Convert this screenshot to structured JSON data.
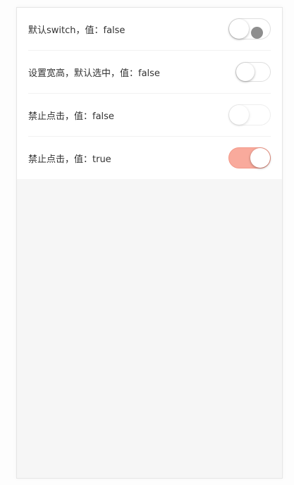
{
  "items": [
    {
      "label": "默认switch，值：false",
      "checked": false,
      "disabled": false
    },
    {
      "label": "设置宽高，默认选中，值：false",
      "checked": false,
      "disabled": false
    },
    {
      "label": "禁止点击，值：false",
      "checked": false,
      "disabled": true
    },
    {
      "label": "禁止点击，值：true",
      "checked": true,
      "disabled": true
    }
  ],
  "colors": {
    "active": "#f9aa9c",
    "background": "#f6f6f6"
  }
}
